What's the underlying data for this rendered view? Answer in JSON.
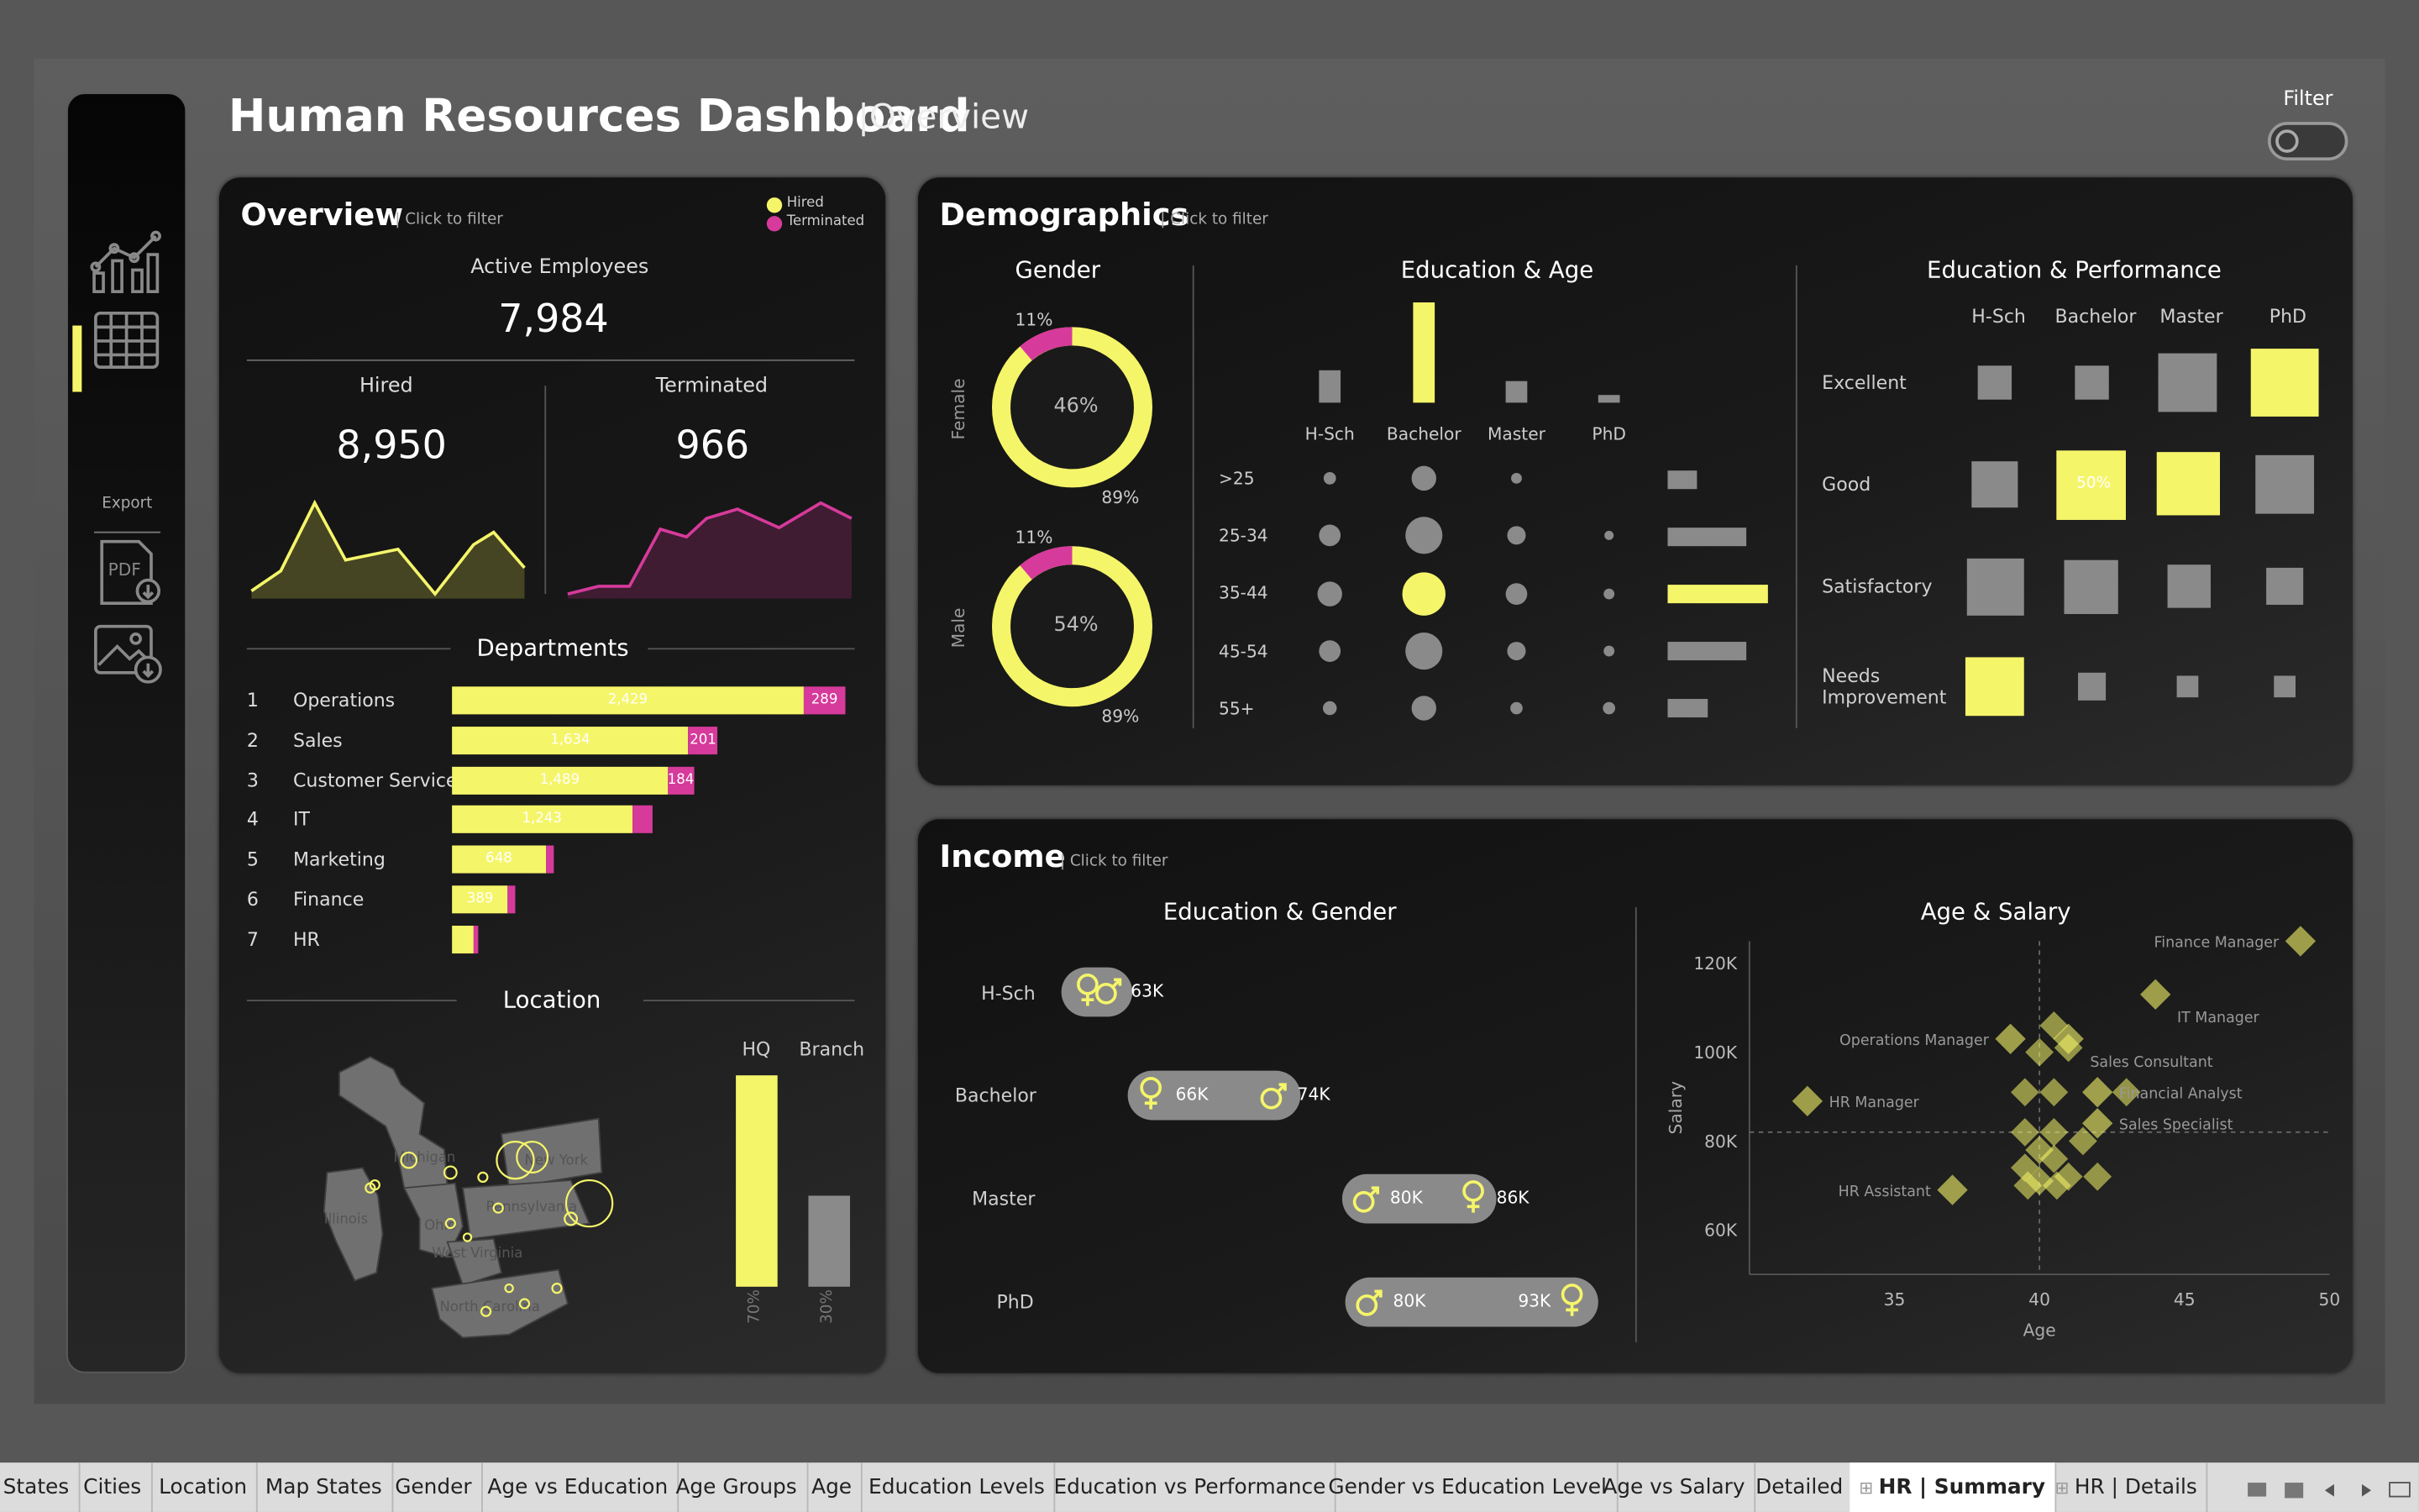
{
  "header": {
    "title": "Human Resources Dashboard",
    "subtitle": "Overview",
    "filter_label": "Filter"
  },
  "sidebar": {
    "export_label": "Export",
    "pdf_label": "PDF"
  },
  "colors": {
    "yellow": "#f5f56a",
    "magenta": "#d63a9a",
    "gray": "#8a8a8a"
  },
  "overview": {
    "title": "Overview",
    "hint": "| Click to filter",
    "legend_hired": "Hired",
    "legend_terminated": "Terminated",
    "active_label": "Active Employees",
    "active_value": "7,984",
    "hired_label": "Hired",
    "hired_value": "8,950",
    "terminated_label": "Terminated",
    "terminated_value": "966",
    "departments_title": "Departments",
    "departments": [
      {
        "rank": "1",
        "name": "Operations",
        "hired": "2,429",
        "term": "289",
        "hired_n": 2429,
        "term_n": 289
      },
      {
        "rank": "2",
        "name": "Sales",
        "hired": "1,634",
        "term": "201",
        "hired_n": 1634,
        "term_n": 201
      },
      {
        "rank": "3",
        "name": "Customer Service",
        "hired": "1,489",
        "term": "184",
        "hired_n": 1489,
        "term_n": 184
      },
      {
        "rank": "4",
        "name": "IT",
        "hired": "1,243",
        "term": "",
        "hired_n": 1243,
        "term_n": 140
      },
      {
        "rank": "5",
        "name": "Marketing",
        "hired": "648",
        "term": "",
        "hired_n": 648,
        "term_n": 60
      },
      {
        "rank": "6",
        "name": "Finance",
        "hired": "389",
        "term": "",
        "hired_n": 389,
        "term_n": 50
      },
      {
        "rank": "7",
        "name": "HR",
        "hired": "",
        "term": "",
        "hired_n": 150,
        "term_n": 20
      }
    ],
    "location_title": "Location",
    "hq_label": "HQ",
    "branch_label": "Branch",
    "hq_pct": "70%",
    "branch_pct": "30%",
    "hq_value": 70,
    "branch_value": 30,
    "map_labels": [
      "Michigan",
      "New York",
      "Illinois",
      "Pennsylvania",
      "Ohio",
      "West Virginia",
      "North Carolina"
    ]
  },
  "demographics": {
    "title": "Demographics",
    "hint": "| Click to filter",
    "gender_title": "Gender",
    "female_label": "Female",
    "female_pct": "46%",
    "female_term": "11%",
    "female_hired": "89%",
    "male_label": "Male",
    "male_pct": "54%",
    "male_term": "11%",
    "male_hired": "89%",
    "edu_age_title": "Education & Age",
    "edu_levels": [
      "H-Sch",
      "Bachelor",
      "Master",
      "PhD"
    ],
    "age_groups": [
      ">25",
      "25-34",
      "35-44",
      "45-54",
      "55+"
    ],
    "edu_perf_title": "Education & Performance",
    "perf_levels": [
      "Excellent",
      "Good",
      "Satisfactory",
      "Needs Improvement"
    ],
    "perf_highlight": "50%"
  },
  "income": {
    "title": "Income",
    "hint": "| Click to filter",
    "edu_gender_title": "Education & Gender",
    "rows": [
      {
        "edu": "H-Sch",
        "a": "63K",
        "b": ""
      },
      {
        "edu": "Bachelor",
        "a": "66K",
        "b": "74K"
      },
      {
        "edu": "Master",
        "a": "80K",
        "b": "86K"
      },
      {
        "edu": "PhD",
        "a": "80K",
        "b": "93K"
      }
    ],
    "age_salary_title": "Age & Salary"
  },
  "chart_data": {
    "type": "scatter",
    "title": "Age & Salary",
    "xlabel": "Age",
    "ylabel": "Salary",
    "x_ticks": [
      "35",
      "40",
      "45",
      "50"
    ],
    "y_ticks": [
      "120K",
      "100K",
      "80K",
      "60K"
    ],
    "xlim": [
      30,
      50
    ],
    "ylim": [
      50,
      125
    ],
    "labeled_points": [
      {
        "name": "Finance Manager",
        "x": 49,
        "y": 125
      },
      {
        "name": "IT Manager",
        "x": 44,
        "y": 113
      },
      {
        "name": "Operations Manager",
        "x": 39,
        "y": 103
      },
      {
        "name": "Sales Consultant",
        "x": 41,
        "y": 103
      },
      {
        "name": "Financial Analyst",
        "x": 42,
        "y": 91
      },
      {
        "name": "HR Manager",
        "x": 32,
        "y": 89
      },
      {
        "name": "Sales Specialist",
        "x": 42,
        "y": 84
      },
      {
        "name": "HR Assistant",
        "x": 37,
        "y": 69
      }
    ],
    "points": [
      [
        40.5,
        106
      ],
      [
        40,
        100
      ],
      [
        41,
        101
      ],
      [
        39.5,
        91
      ],
      [
        40.5,
        91
      ],
      [
        43,
        91
      ],
      [
        39.5,
        82
      ],
      [
        40.5,
        82
      ],
      [
        41.5,
        80
      ],
      [
        40,
        78
      ],
      [
        40.5,
        76
      ],
      [
        39.5,
        74
      ],
      [
        40,
        71
      ],
      [
        41,
        72
      ],
      [
        42,
        72
      ],
      [
        39.6,
        70
      ],
      [
        40.6,
        70
      ]
    ]
  },
  "tabs": [
    "States",
    "Cities",
    "Location",
    "Map States",
    "Gender",
    "Age vs Education",
    "Age Groups",
    "Age",
    "Education Levels",
    "Education vs Performance",
    "Gender vs Education Level",
    "Age vs Salary",
    "Detailed",
    "HR | Summary",
    "HR | Details"
  ]
}
